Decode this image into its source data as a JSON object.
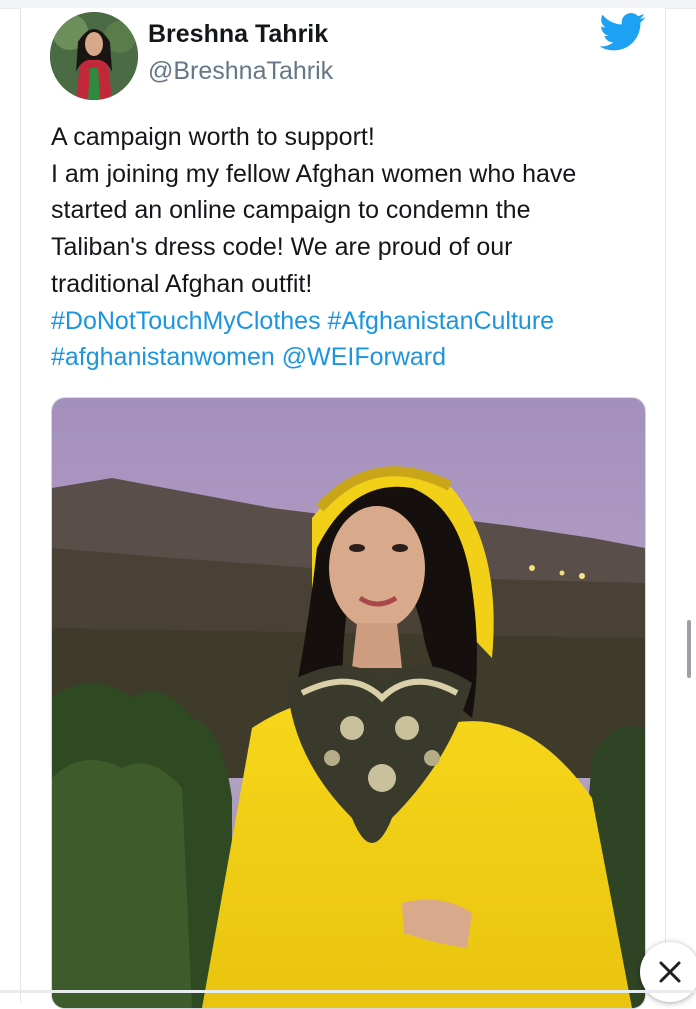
{
  "user": {
    "name": "Breshna Tahrik",
    "handle": "@BreshnaTahrik"
  },
  "tweet": {
    "lines": [
      "A campaign worth to support!",
      "I am joining my fellow Afghan women who have",
      "started an online campaign to condemn the",
      "Taliban's dress code! We are proud of our",
      "traditional Afghan outfit!"
    ],
    "hashtag_1": "#DoNotTouchMyClothes",
    "hashtag_2": "#AfghanistanCulture",
    "hashtag_3": "#afghanistanwomen",
    "mention": "@WEIForward"
  },
  "icons": {
    "brand": "twitter-bird-icon",
    "close": "close-icon"
  },
  "colors": {
    "link": "#1b95e0",
    "twitter_blue": "#1da1f2",
    "text": "#14171a",
    "muted": "#657786"
  }
}
